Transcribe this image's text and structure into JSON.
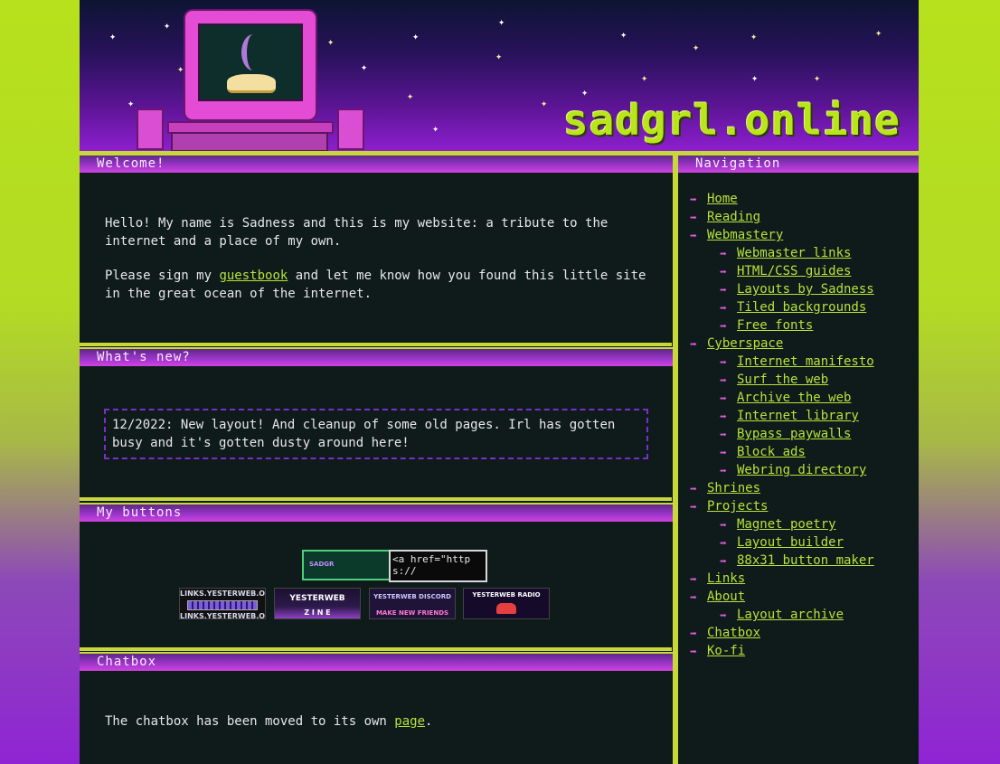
{
  "site": {
    "title": "sadgrl.online"
  },
  "welcome": {
    "heading": "Welcome!",
    "para1": "Hello! My name is Sadness and this is my website: a tribute to the internet and a place of my own.",
    "para2_before": "Please sign my ",
    "para2_link": "guestbook",
    "para2_after": " and let me know how you found this little site in the great ocean of the internet."
  },
  "news": {
    "heading": "What's new?",
    "entry": "12/2022: New layout! And cleanup of some old pages. Irl has gotten busy and it's gotten dusty around here!"
  },
  "buttons": {
    "heading": "My buttons",
    "sadgrl_button_text": "SADGR",
    "code_box_text": "<a href=\"https://",
    "badges": [
      {
        "line1": "LINKS.YESTERWEB.ORG",
        "line2": "LINKS.YESTERWEB.ORG"
      },
      {
        "line1": "YESTERWEB",
        "line2": "Z I N E"
      },
      {
        "line1": "YESTERWEB DISCORD",
        "line2": "MAKE NEW FRIENDS"
      },
      {
        "line1": "YESTERWEB RADIO",
        "line2": ""
      }
    ]
  },
  "chat": {
    "heading": "Chatbox",
    "text_before": "The chatbox has been moved to its own ",
    "link": "page",
    "text_after": "."
  },
  "nav": {
    "heading": "Navigation",
    "items": [
      {
        "label": "Home",
        "level": 0
      },
      {
        "label": "Reading",
        "level": 0
      },
      {
        "label": "Webmastery",
        "level": 0
      },
      {
        "label": "Webmaster links",
        "level": 1
      },
      {
        "label": "HTML/CSS guides",
        "level": 1
      },
      {
        "label": "Layouts by Sadness",
        "level": 1
      },
      {
        "label": "Tiled backgrounds",
        "level": 1
      },
      {
        "label": "Free fonts",
        "level": 1
      },
      {
        "label": "Cyberspace",
        "level": 0
      },
      {
        "label": "Internet manifesto",
        "level": 1
      },
      {
        "label": "Surf the web",
        "level": 1
      },
      {
        "label": "Archive the web",
        "level": 1
      },
      {
        "label": "Internet library",
        "level": 1
      },
      {
        "label": "Bypass paywalls",
        "level": 1
      },
      {
        "label": "Block ads",
        "level": 1
      },
      {
        "label": "Webring directory",
        "level": 1
      },
      {
        "label": "Shrines",
        "level": 0
      },
      {
        "label": "Projects",
        "level": 0
      },
      {
        "label": "Magnet poetry",
        "level": 1
      },
      {
        "label": "Layout builder",
        "level": 1
      },
      {
        "label": "88x31 button maker",
        "level": 1
      },
      {
        "label": "Links",
        "level": 0
      },
      {
        "label": "About",
        "level": 0
      },
      {
        "label": "Layout archive",
        "level": 1
      },
      {
        "label": "Chatbox",
        "level": 0
      },
      {
        "label": "Ko-fi",
        "level": 0
      }
    ]
  },
  "colors": {
    "accent_green": "#b8e43a",
    "accent_pink": "#e05ae0",
    "panel_bg": "#0f1a1b"
  }
}
